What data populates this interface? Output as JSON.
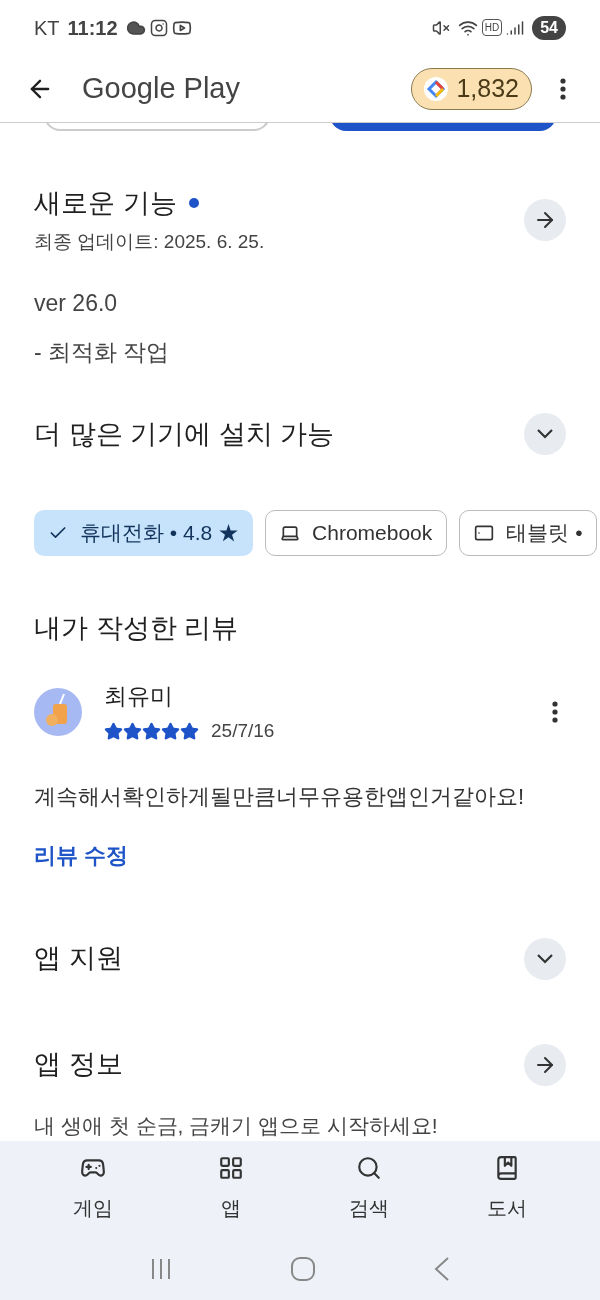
{
  "status_bar": {
    "carrier": "KT",
    "time": "11:12",
    "hd": "HD",
    "battery": "54"
  },
  "header": {
    "title": "Google Play",
    "points": "1,832"
  },
  "whats_new": {
    "title": "새로운 기능",
    "new_dot": true,
    "updated": "최종 업데이트: 2025. 6. 25.",
    "lines": [
      "ver 26.0",
      "- 최적화 작업"
    ]
  },
  "devices": {
    "title": "더 많은 기기에 설치 가능",
    "expanded": false,
    "chips": [
      {
        "kind": "phone",
        "label": "휴대전화 • 4.8 ★",
        "selected": true
      },
      {
        "kind": "laptop",
        "label": "Chromebook",
        "selected": false
      },
      {
        "kind": "tablet",
        "label": "태블릿 •",
        "selected": false
      }
    ]
  },
  "my_review": {
    "title": "내가 작성한 리뷰",
    "author": "최유미",
    "stars": 5,
    "date": "25/7/16",
    "text": "계속해서확인하게될만큼너무유용한앱인거같아요!",
    "edit_link": "리뷰 수정"
  },
  "app_support": {
    "title": "앱 지원",
    "expanded": false
  },
  "app_info": {
    "title": "앱 정보",
    "description": "내 생애 첫 순금, 금캐기 앱으로 시작하세요!"
  },
  "bottom_nav": [
    {
      "kind": "games",
      "label": "게임",
      "selected": false
    },
    {
      "kind": "apps",
      "label": "앱",
      "selected": false
    },
    {
      "kind": "search",
      "label": "검색",
      "selected": false
    },
    {
      "kind": "books",
      "label": "도서",
      "selected": false
    }
  ]
}
